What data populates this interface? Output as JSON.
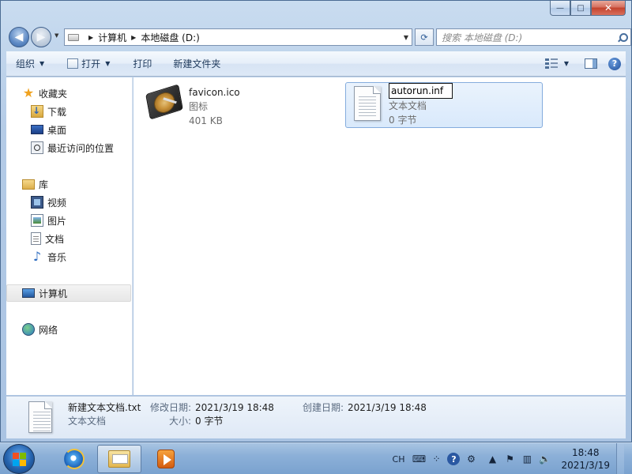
{
  "window": {
    "minimize_glyph": "—",
    "maximize_glyph": "□",
    "close_glyph": "✕"
  },
  "nav": {
    "breadcrumbs": [
      "计算机",
      "本地磁盘 (D:)"
    ],
    "search_placeholder": "搜索 本地磁盘 (D:)"
  },
  "toolbar": {
    "organize": "组织",
    "open": "打开",
    "print": "打印",
    "new_folder": "新建文件夹",
    "help": "?"
  },
  "sidebar": {
    "favorites": "收藏夹",
    "downloads": "下载",
    "desktop": "桌面",
    "recent": "最近访问的位置",
    "libraries": "库",
    "videos": "视频",
    "pictures": "图片",
    "documents": "文档",
    "music": "音乐",
    "computer": "计算机",
    "network": "网络"
  },
  "files": [
    {
      "name": "favicon.ico",
      "type": "图标",
      "size": "401 KB",
      "icon": "hard-disk-icon"
    },
    {
      "name": "autorun.inf",
      "type": "文本文档",
      "size": "0 字节",
      "icon": "text-file-icon",
      "renaming": true
    }
  ],
  "details": {
    "file_name": "新建文本文档.txt",
    "file_type": "文本文档",
    "modified_label": "修改日期:",
    "modified_value": "2021/3/19 18:48",
    "created_label": "创建日期:",
    "created_value": "2021/3/19 18:48",
    "size_label": "大小:",
    "size_value": "0 字节"
  },
  "taskbar": {
    "lang": "CH",
    "help": "?",
    "time": "18:48",
    "date": "2021/3/19"
  },
  "colors": {
    "selection_border": "#84acdd",
    "selection_fill": "#d9e9fb",
    "taskbar": "#8cb0d8"
  }
}
